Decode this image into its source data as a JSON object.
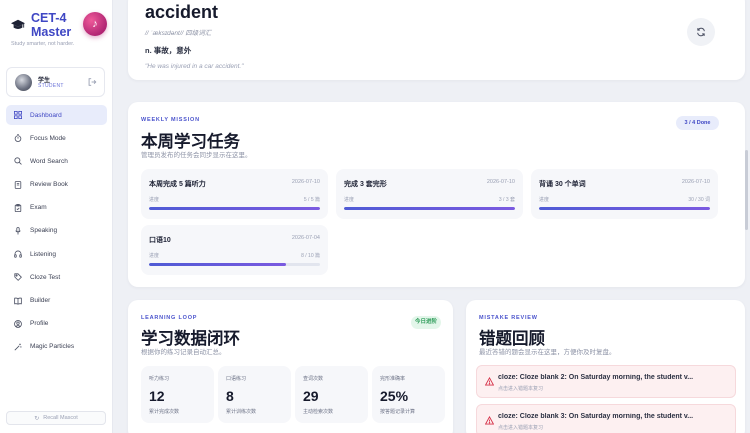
{
  "brand": {
    "title": "CET-4 Master",
    "tagline": "Study smarter, not harder."
  },
  "user": {
    "name": "学生",
    "role": "STUDENT"
  },
  "nav": [
    {
      "label": "Dashboard",
      "icon": "dashboard-icon"
    },
    {
      "label": "Focus Mode",
      "icon": "stopwatch-icon"
    },
    {
      "label": "Word Search",
      "icon": "search-icon"
    },
    {
      "label": "Review Book",
      "icon": "book-icon"
    },
    {
      "label": "Exam",
      "icon": "clipboard-icon"
    },
    {
      "label": "Speaking",
      "icon": "microphone-icon"
    },
    {
      "label": "Listening",
      "icon": "headphones-icon"
    },
    {
      "label": "Cloze Test",
      "icon": "tag-icon"
    },
    {
      "label": "Builder",
      "icon": "open-book-icon"
    },
    {
      "label": "Profile",
      "icon": "profile-icon"
    },
    {
      "label": "Magic Particles",
      "icon": "magic-wand-icon"
    }
  ],
  "recall_label": "Recall Mascot",
  "word": {
    "word": "accident",
    "phonetic": "// ˈæksɪdənt//  四级词汇",
    "meaning": "n. 事故，意外",
    "example": "\"He was injured in a car accident.\""
  },
  "mission": {
    "eyebrow": "WEEKLY MISSION",
    "title": "本周学习任务",
    "subtitle": "管理员发布的任务会同步显示在这里。",
    "badge": "3 / 4 Done",
    "tasks": [
      {
        "name": "本周完成 5 篇听力",
        "date": "2026-07-10",
        "label": "进度",
        "count": "5 / 5 篇",
        "progress": 1.0
      },
      {
        "name": "完成 3 套完形",
        "date": "2026-07-10",
        "label": "进度",
        "count": "3 / 3 套",
        "progress": 1.0
      },
      {
        "name": "背诵 30 个单词",
        "date": "2026-07-10",
        "label": "进度",
        "count": "30 / 30 词",
        "progress": 1.0
      },
      {
        "name": "口语10",
        "date": "2026-07-04",
        "label": "进度",
        "count": "8 / 10 篇",
        "progress": 0.8
      }
    ]
  },
  "loop": {
    "eyebrow": "LEARNING LOOP",
    "title": "学习数据闭环",
    "subtitle": "根据你的练习记录自动汇总。",
    "badge": "今日进阶",
    "stats": [
      {
        "label": "听力练习",
        "value": "12",
        "note": "累计完成次数"
      },
      {
        "label": "口语练习",
        "value": "8",
        "note": "累计训练次数"
      },
      {
        "label": "查词次数",
        "value": "29",
        "note": "主动检索次数"
      },
      {
        "label": "完形准确率",
        "value": "25%",
        "note": "按答题记录计算"
      }
    ]
  },
  "mistakes": {
    "eyebrow": "MISTAKE REVIEW",
    "title": "错题回顾",
    "subtitle": "最近答错的题会显示在这里，方便你及时复盘。",
    "items": [
      {
        "title": "cloze: Cloze blank 2: On Saturday morning, the student v...",
        "sub": "点击进入错题本复习"
      },
      {
        "title": "cloze: Cloze blank 3: On Saturday morning, the student v...",
        "sub": "点击进入错题本复习"
      }
    ]
  },
  "colors": {
    "accent": "#3f47c4",
    "progress": "#5b5bd9",
    "success": "#2c9b58",
    "danger": "#d6334a"
  }
}
